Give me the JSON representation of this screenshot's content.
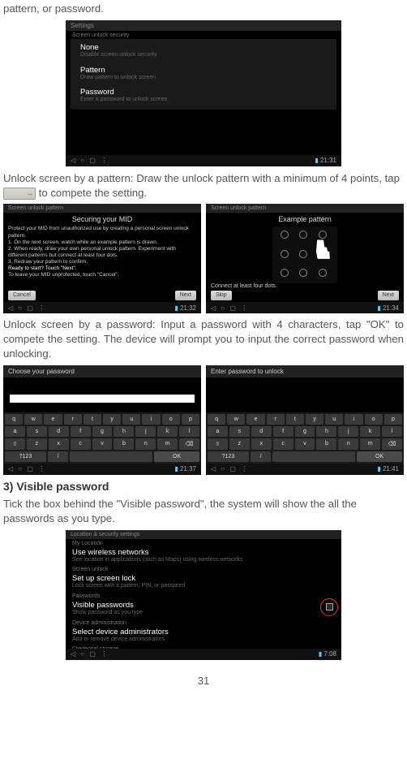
{
  "intro_line": "pattern, or password.",
  "shot1": {
    "title": "Settings",
    "section": "Screen unlock security",
    "items": [
      {
        "title": "None",
        "sub": "Disable screen unlock security"
      },
      {
        "title": "Pattern",
        "sub": "Draw pattern to unlock screen"
      },
      {
        "title": "Password",
        "sub": "Enter a password to unlock screen"
      }
    ],
    "time": "21:31"
  },
  "p2": "Unlock screen by a pattern: Draw the unlock pattern with a minimum of 4 points, tap ",
  "p2_tail": " to compete the setting.",
  "pair1": {
    "left": {
      "heading": "Securing your MID",
      "lines": [
        "Protect your MID from unauthorized use by creating a personal screen unlock pattern.",
        "1. On the next screen, watch while an example pattern is drawn.",
        "2. When ready, draw your own personal unlock pattern. Experiment with different patterns but connect at least four dots.",
        "3. Redraw your pattern to confirm.",
        "Ready to start? Touch \"Next\".",
        "To leave your MID unprotected, touch \"Cancel\"."
      ],
      "btn_left": "Cancel",
      "btn_right": "Next",
      "time": "21:32"
    },
    "right": {
      "heading": "Example pattern",
      "hint": "Connect at least four dots.",
      "btn_left": "Skip",
      "btn_right": "Next",
      "time": "21:34"
    }
  },
  "p3": "Unlock screen by a password: Input a password with 4 characters, tap \"OK\" to compete the setting. The device will prompt you to input the correct password when unlocking.",
  "pair2": {
    "left": {
      "header": "Choose your password",
      "time": "21:37"
    },
    "right": {
      "header": "Enter password to unlock",
      "ok": "OK",
      "time": "21:41"
    }
  },
  "keyboard": {
    "r1": [
      "q",
      "w",
      "e",
      "r",
      "t",
      "y",
      "u",
      "i",
      "o",
      "p"
    ],
    "r2": [
      "a",
      "s",
      "d",
      "f",
      "g",
      "h",
      "j",
      "k",
      "l"
    ],
    "r3": [
      "⇧",
      "z",
      "x",
      "c",
      "v",
      "b",
      "n",
      "m",
      "⌫"
    ],
    "r4": [
      "?123",
      "/",
      "",
      "OK"
    ]
  },
  "h_visible": "3) Visible password",
  "p4": "Tick the box behind the \"Visible password\", the system will show the all the passwords as you type.",
  "shot_last": {
    "crumb": "Location & security settings",
    "sections": [
      {
        "label": "My Location",
        "items": [
          {
            "title": "Use wireless networks",
            "sub": "See location in applications (such as Maps) using wireless networks"
          }
        ]
      },
      {
        "label": "Screen unlock",
        "items": [
          {
            "title": "Set up screen lock",
            "sub": "Lock screen with a pattern, PIN, or password"
          }
        ]
      },
      {
        "label": "Passwords",
        "items": [
          {
            "title": "Visible passwords",
            "sub": "Show password as you type"
          }
        ]
      },
      {
        "label": "Device administration",
        "items": [
          {
            "title": "Select device administrators",
            "sub": "Add or remove device administrators"
          }
        ]
      },
      {
        "label": "Credential storage",
        "items": []
      }
    ],
    "time": "7:08"
  },
  "pagenum": "31"
}
